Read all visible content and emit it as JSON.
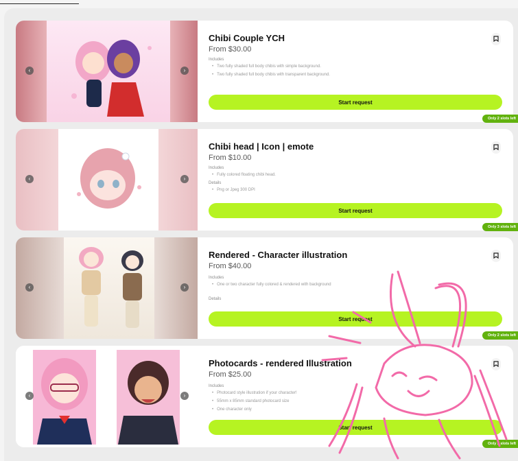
{
  "listings": [
    {
      "title": "Chibi Couple YCH",
      "price": "From $30.00",
      "sections": [
        {
          "heading": "Includes",
          "items": [
            "Two fully shaded full body chibis with simple background.",
            "Two fully shaded full body chibis with transparent background."
          ]
        }
      ],
      "cta": "Start request",
      "slots": "Only 2 slots left"
    },
    {
      "title": "Chibi head | Icon | emote",
      "price": "From $10.00",
      "sections": [
        {
          "heading": "Includes",
          "items": [
            "Fully colored floating chibi head."
          ]
        },
        {
          "heading": "Details",
          "items": [
            "Png or Jpeg 300 DPI"
          ]
        }
      ],
      "cta": "Start request",
      "slots": "Only 3 slots left"
    },
    {
      "title": "Rendered - Character illustration",
      "price": "From $40.00",
      "sections": [
        {
          "heading": "Includes",
          "items": [
            "One or two character fully colored & rendered with background"
          ]
        },
        {
          "heading": "Details",
          "items": []
        }
      ],
      "cta": "Start request",
      "slots": "Only 2 slots left"
    },
    {
      "title": "Photocards - rendered Illustration",
      "price": "From $25.00",
      "sections": [
        {
          "heading": "Includes",
          "items": [
            "Photocard style illustration if your character!",
            "55mm x 85mm standard photocard size",
            "One character only"
          ]
        }
      ],
      "cta": "Start request",
      "slots": "Only 2 slots left"
    }
  ],
  "colors": {
    "accent_button": "#b6f322",
    "slots_badge": "#62b20e",
    "doodle": "#f26aa8"
  },
  "icons": {
    "prev": "chevron-left-icon",
    "next": "chevron-right-icon",
    "save": "bookmark-icon"
  }
}
